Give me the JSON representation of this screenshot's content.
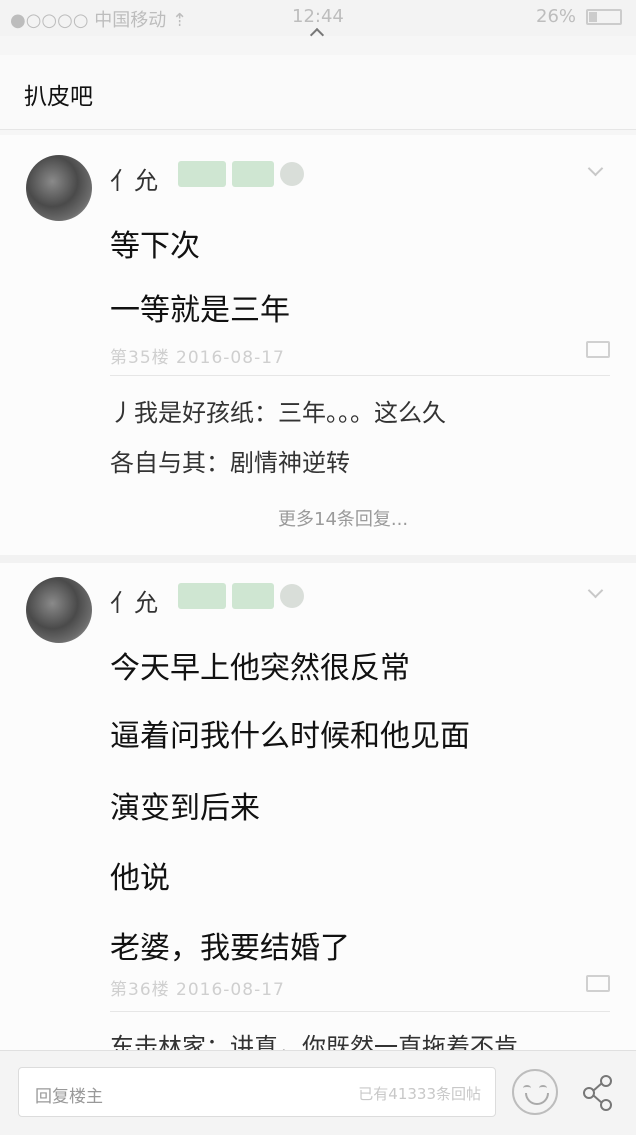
{
  "status": {
    "carrier": "●○○○○ 中国移动 ⇡",
    "time": "12:44",
    "battery": "26%",
    "battery_level": 0.26
  },
  "header": {
    "title": "扒皮吧"
  },
  "posts": [
    {
      "username": "亻允",
      "lines": [
        "等下次",
        "一等就是三年"
      ],
      "meta": "第35楼 2016-08-17",
      "replies": [
        "丿我是好孩纸：三年。。。这么久",
        "各自与其：剧情神逆转"
      ],
      "more": "更多14条回复..."
    },
    {
      "username": "亻允",
      "lines": [
        "今天早上他突然很反常",
        "逼着问我什么时候和他见面",
        "演变到后来",
        "他说",
        "老婆，我要结婚了"
      ],
      "meta": "第36楼 2016-08-17",
      "replies": [
        "东击林家：讲真，你既然一直拖着不肯"
      ]
    }
  ],
  "bottom": {
    "placeholder": "回复楼主",
    "count": "已有41333条回帖"
  },
  "icons": {
    "comment": "comment-icon",
    "emoji": "emoji-icon",
    "share": "share-icon",
    "more": "chevron-down-icon"
  },
  "colors": {
    "badge": "#cfe6d2",
    "text": "#111111",
    "muted": "#cfcfcf"
  }
}
